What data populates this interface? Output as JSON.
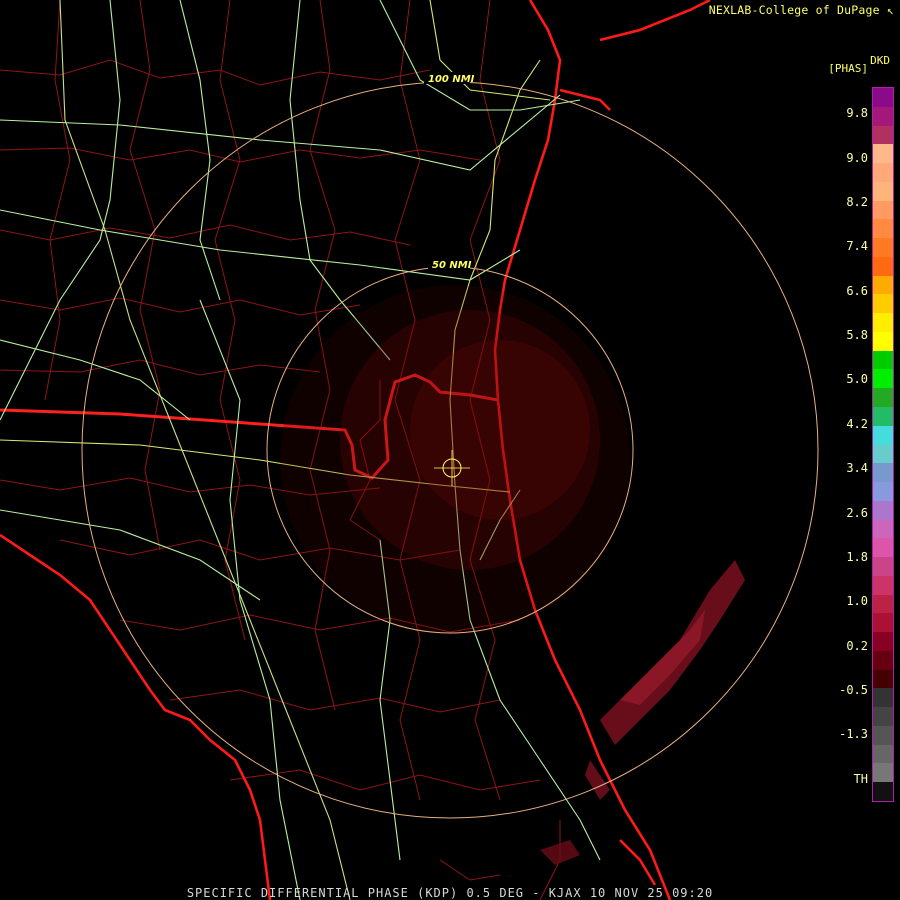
{
  "header": {
    "credit": "NEXLAB-College of DuPage",
    "product_code": "DKD",
    "unit": "[PHAS]"
  },
  "footer": {
    "caption": "SPECIFIC DIFFERENTIAL PHASE (KDP) 0.5 DEG - KJAX 10 NOV 25 09:20"
  },
  "range_rings": {
    "inner_label": "50 NMI",
    "outer_label": "100 NMI"
  },
  "colorbar": {
    "labels": [
      "9.8",
      "9.0",
      "8.2",
      "7.4",
      "6.6",
      "5.8",
      "5.0",
      "4.2",
      "3.4",
      "2.6",
      "1.8",
      "1.0",
      "0.2",
      "-0.5",
      "-1.3",
      "TH"
    ],
    "colors": [
      "#8a0a8a",
      "#a4187a",
      "#b03060",
      "#ffb88a",
      "#ffa878",
      "#ffb47a",
      "#ff9a60",
      "#ff8a40",
      "#ff7a20",
      "#ff6a10",
      "#ffaa00",
      "#ffcc00",
      "#ffee00",
      "#ffff00",
      "#00cc00",
      "#00ee00",
      "#22aa22",
      "#22bb66",
      "#44dddd",
      "#66cccc",
      "#7799cc",
      "#8899dd",
      "#aa77cc",
      "#cc66bb",
      "#dd55aa",
      "#cc4488",
      "#cc3366",
      "#bb2244",
      "#aa1133",
      "#880022",
      "#660011",
      "#440000",
      "#333333",
      "#444444",
      "#555555",
      "#666666",
      "#777777",
      "#111111"
    ]
  },
  "icons": {
    "logo": "nexlab-corner-icon"
  }
}
